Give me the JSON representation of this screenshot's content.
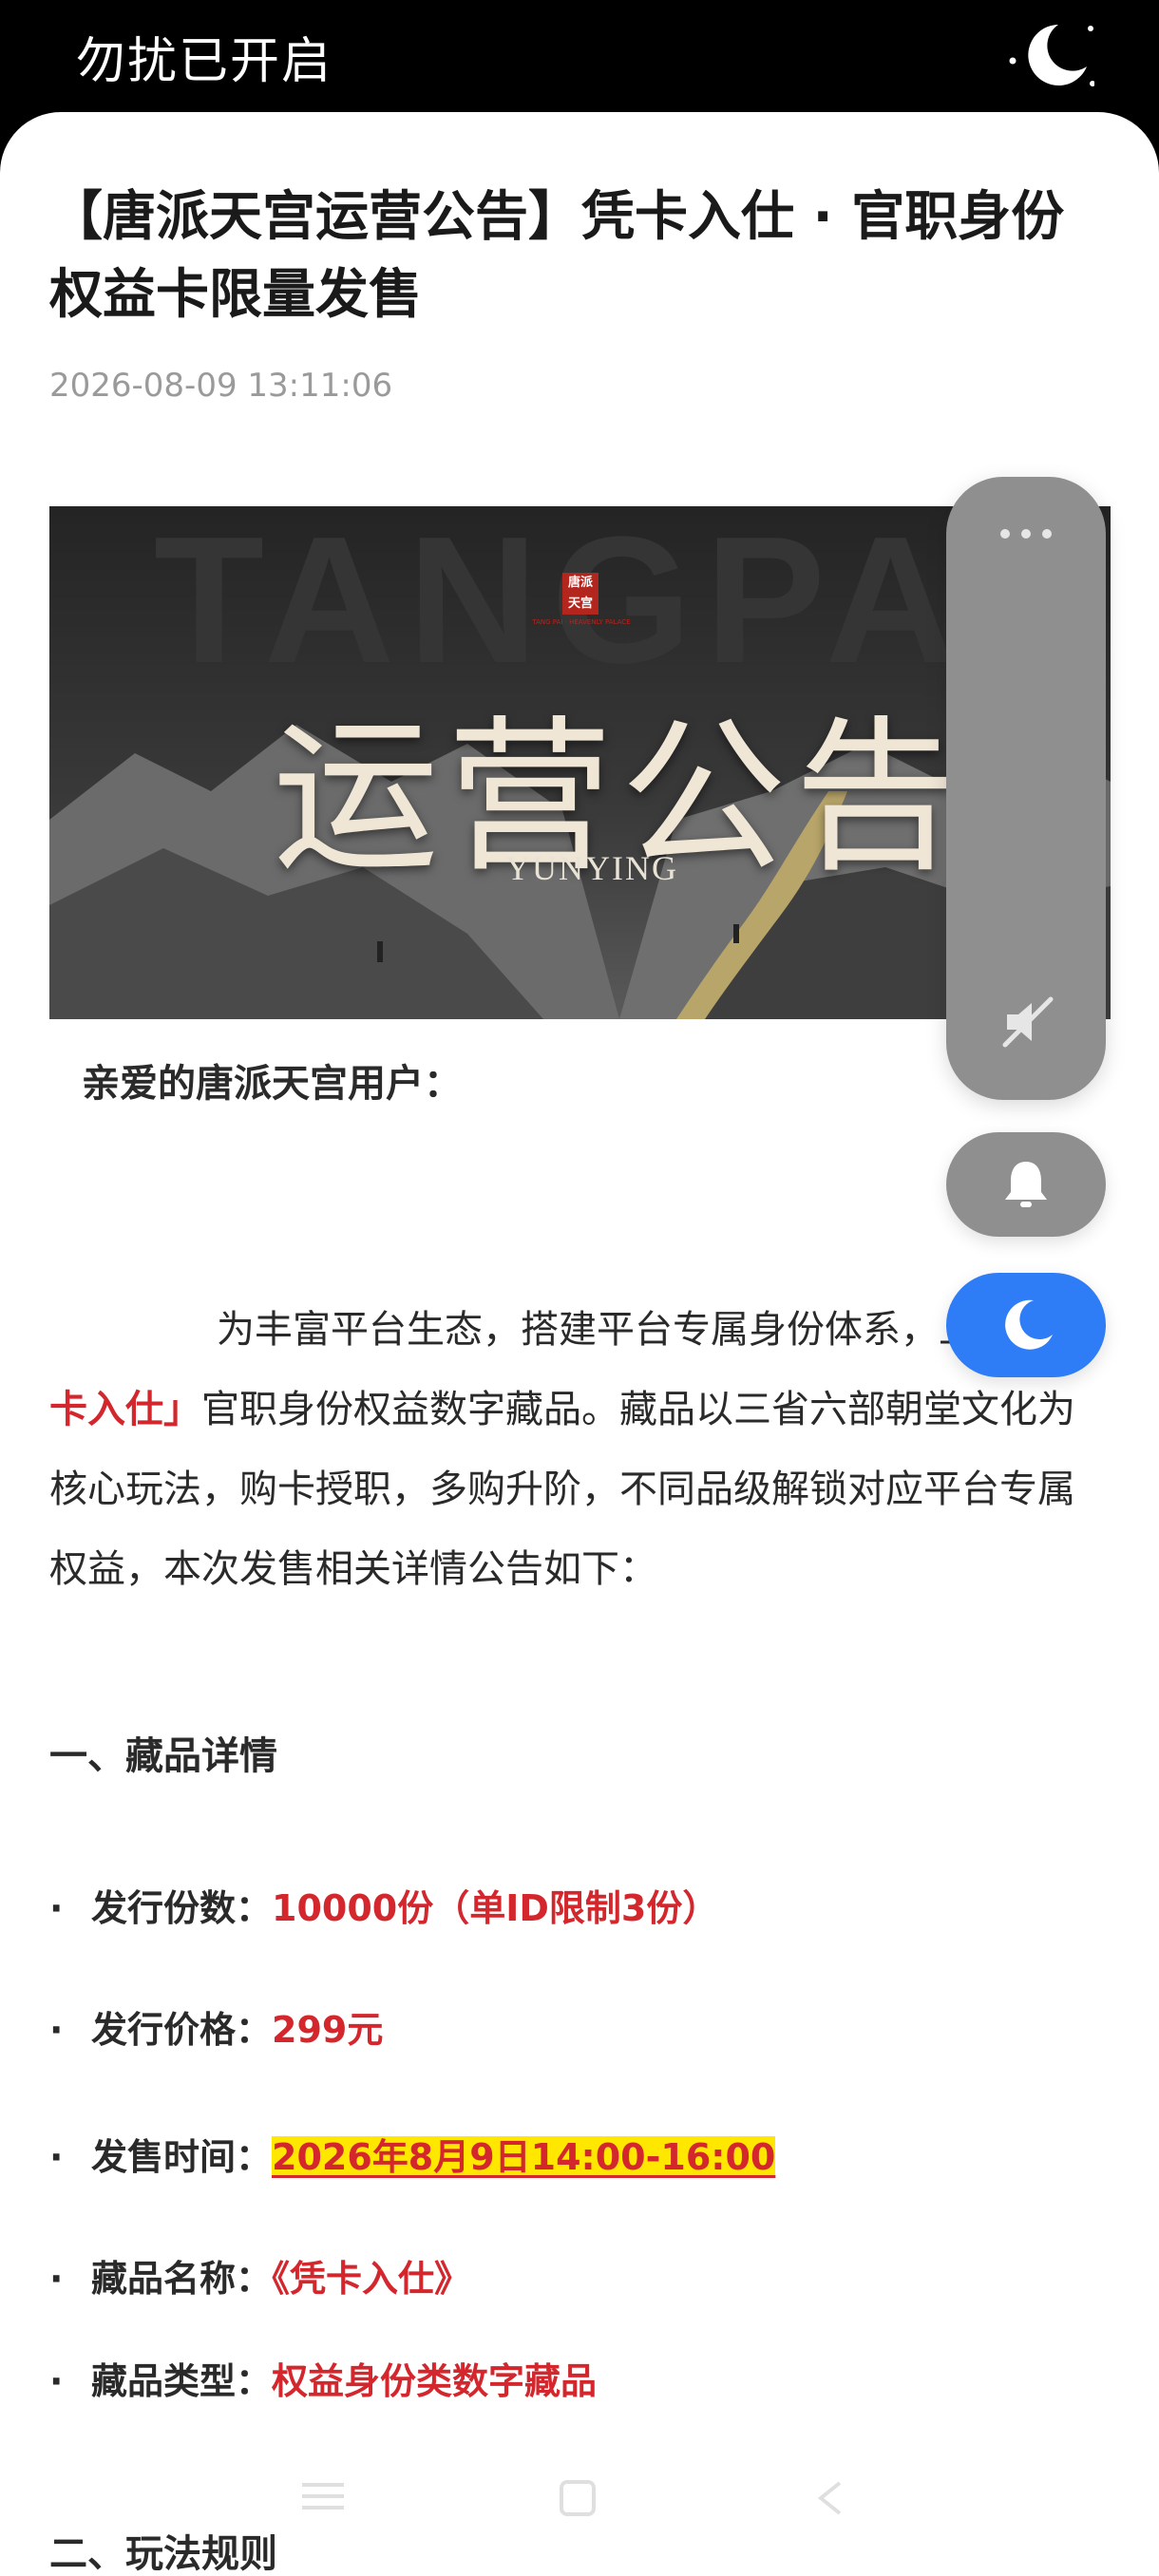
{
  "status_bar": {
    "dnd_text": "勿扰已开启"
  },
  "article": {
    "title": "【唐派天宫运营公告】凭卡入仕 · 官职身份权益卡限量发售",
    "date": "2026-08-09 13:11:06",
    "banner": {
      "bg_text": "TANGPA",
      "seal_text": "唐派天宫",
      "seal_caption": "TANG PAI · HEAVENLY PALACE",
      "headline": "运营公告",
      "sub": "YUNYING"
    },
    "greeting": "亲爱的唐派天宫用户：",
    "intro": {
      "part1": "为丰富平台生态，搭建平台专属身份体系，上线",
      "highlight": "「凭卡入仕」",
      "part2": "官职身份权益数字藏品。藏品以三省六部朝堂文化为核心玩法，购卡授职，多购升阶，不同品级解锁对应平台专属权益，本次发售相关详情公告如下："
    },
    "section1_title": "一、藏品详情",
    "details": [
      {
        "label": "发行份数：",
        "value": "10000份（单ID限制3份）"
      },
      {
        "label": "发行价格：",
        "value": "299元"
      },
      {
        "label": "发售时间：",
        "value": "2026年8月9日14:00-16:00"
      },
      {
        "label": "藏品名称：",
        "value": "《凭卡入仕》"
      },
      {
        "label": "藏品类型：",
        "value": "权益身份类数字藏品"
      }
    ],
    "section2_title": "二、玩法规则"
  },
  "floating_controls": {
    "icons": [
      "more-icon",
      "mute-icon",
      "bell-icon",
      "moon-icon"
    ],
    "accent": "#2f7df6",
    "panel_color": "#8f8f8f"
  },
  "colors": {
    "highlight_red": "#d3272d",
    "highlight_yellow": "#ffe700"
  }
}
